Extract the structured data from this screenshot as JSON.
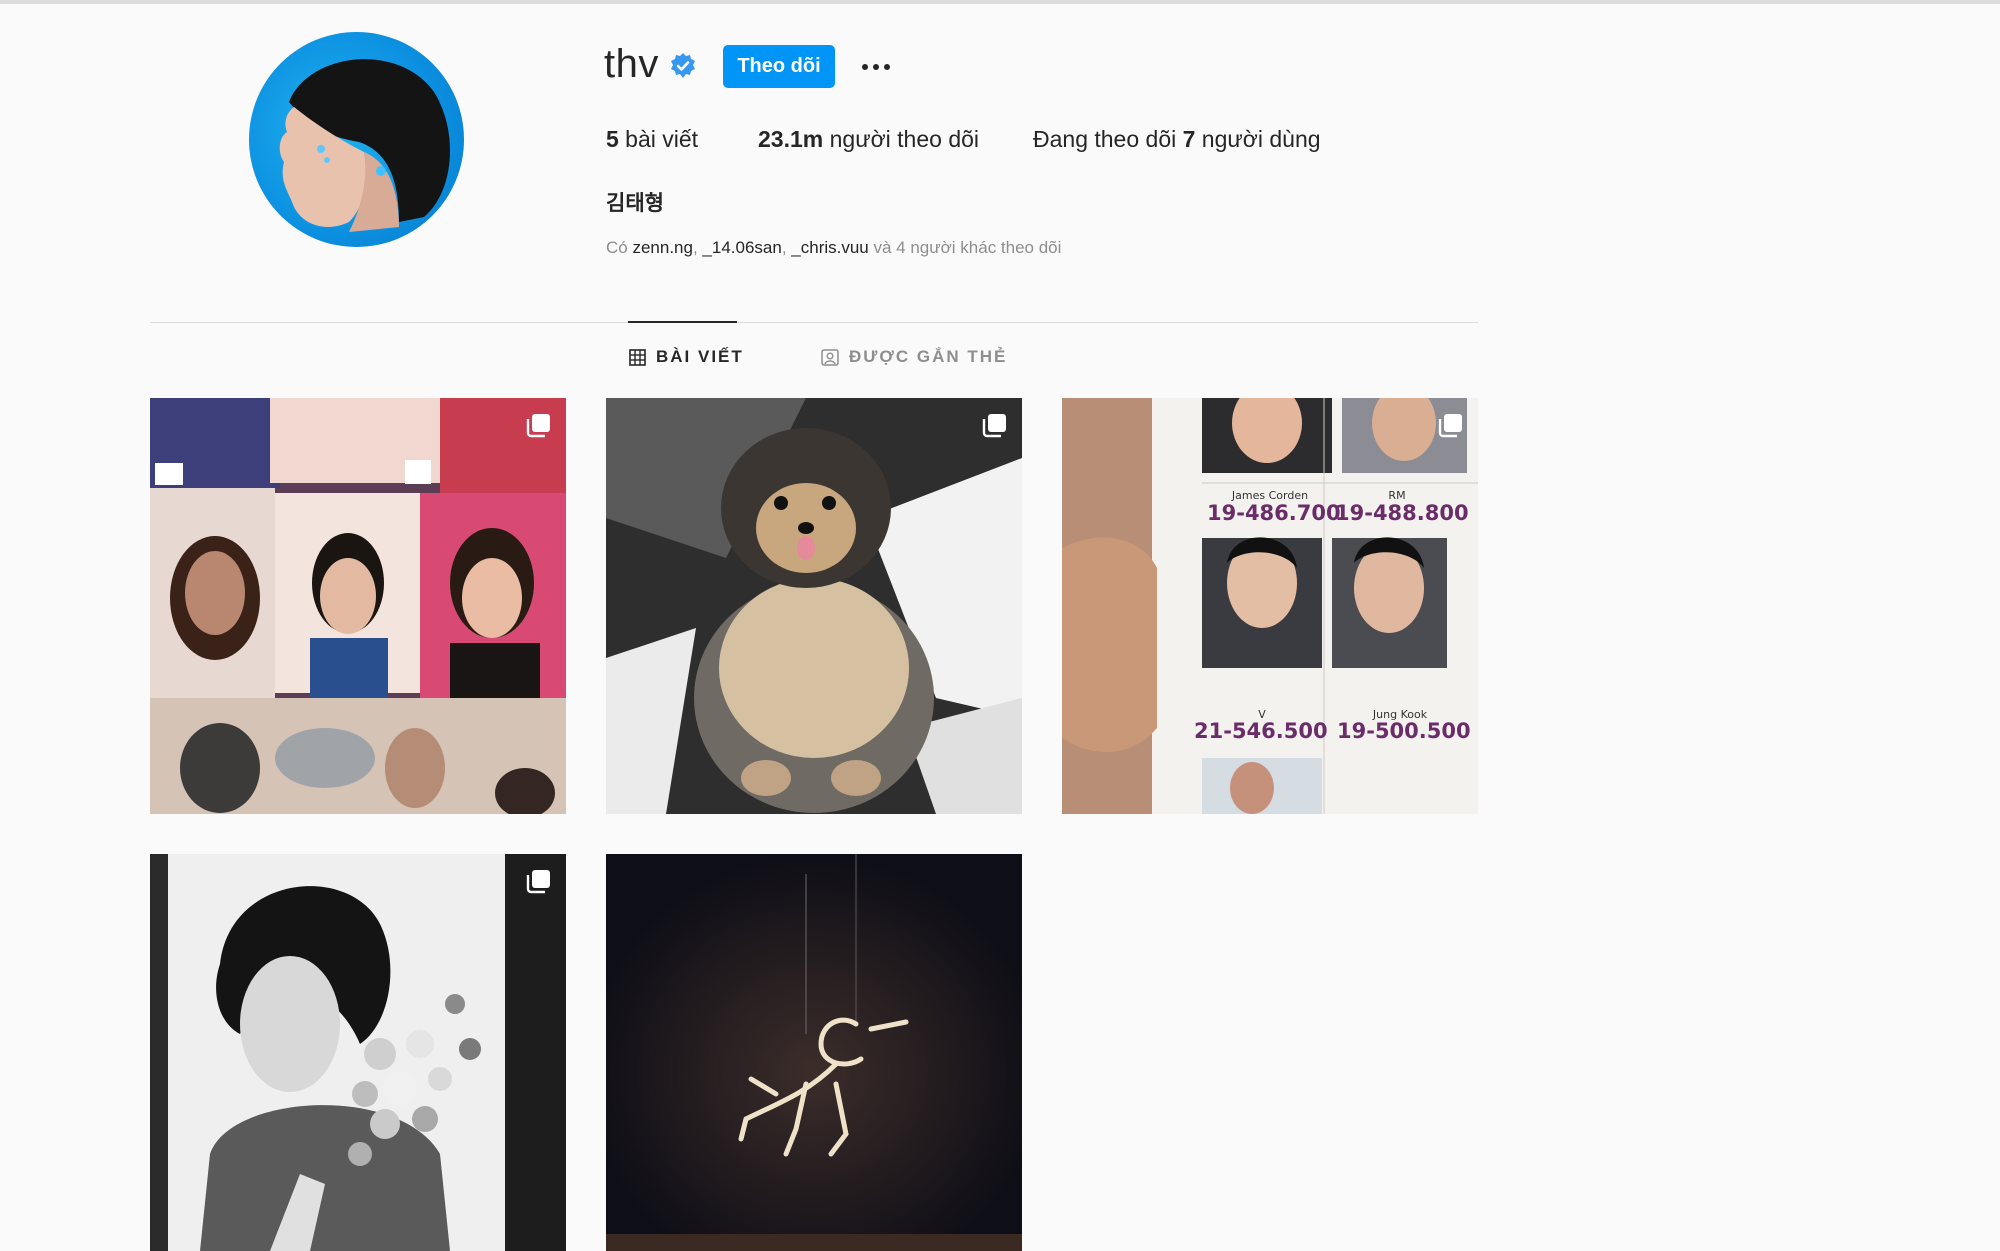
{
  "profile": {
    "username": "thv",
    "full_name": "김태형",
    "follow_label": "Theo dõi",
    "more_label": "•••",
    "stats": {
      "posts_count": "5",
      "posts_label": " bài viết",
      "followers_count": "23.1m",
      "followers_label": " người theo dõi",
      "following_prefix": "Đang theo dõi ",
      "following_count": "7",
      "following_suffix": " người dùng"
    },
    "followed_by": {
      "prefix": "Có ",
      "users": [
        "zenn.ng",
        "_14.06san",
        "_chris.vuu"
      ],
      "suffix": " và 4 người khác theo dõi"
    }
  },
  "tabs": [
    {
      "label": "BÀI VIẾT",
      "icon": "grid-icon",
      "active": true
    },
    {
      "label": "ĐƯỢC GẮN THẺ",
      "icon": "tagged-icon",
      "active": false
    }
  ],
  "posts": [
    {
      "subject": "photo-booth collage",
      "multi": true,
      "text": {
        "left_name": "",
        "right_name": ""
      }
    },
    {
      "subject": "pomeranian dog",
      "multi": true
    },
    {
      "subject": "award seating chart",
      "multi": true,
      "labels": {
        "name_1": "James Corden",
        "name_2": "RM",
        "seat_1": "19-486.700",
        "seat_2": "19-488.800",
        "name_3": "V",
        "name_4": "Jung Kook",
        "seat_3": "21-546.500",
        "seat_4": "19-500.500"
      }
    },
    {
      "subject": "black and white portrait with flowers",
      "multi": true
    },
    {
      "subject": "bird skeleton sculpture",
      "multi": false
    }
  ],
  "colors": {
    "accent": "#0095f6",
    "text": "#262626",
    "muted": "#8e8e8e",
    "verified": "#0095f6"
  }
}
